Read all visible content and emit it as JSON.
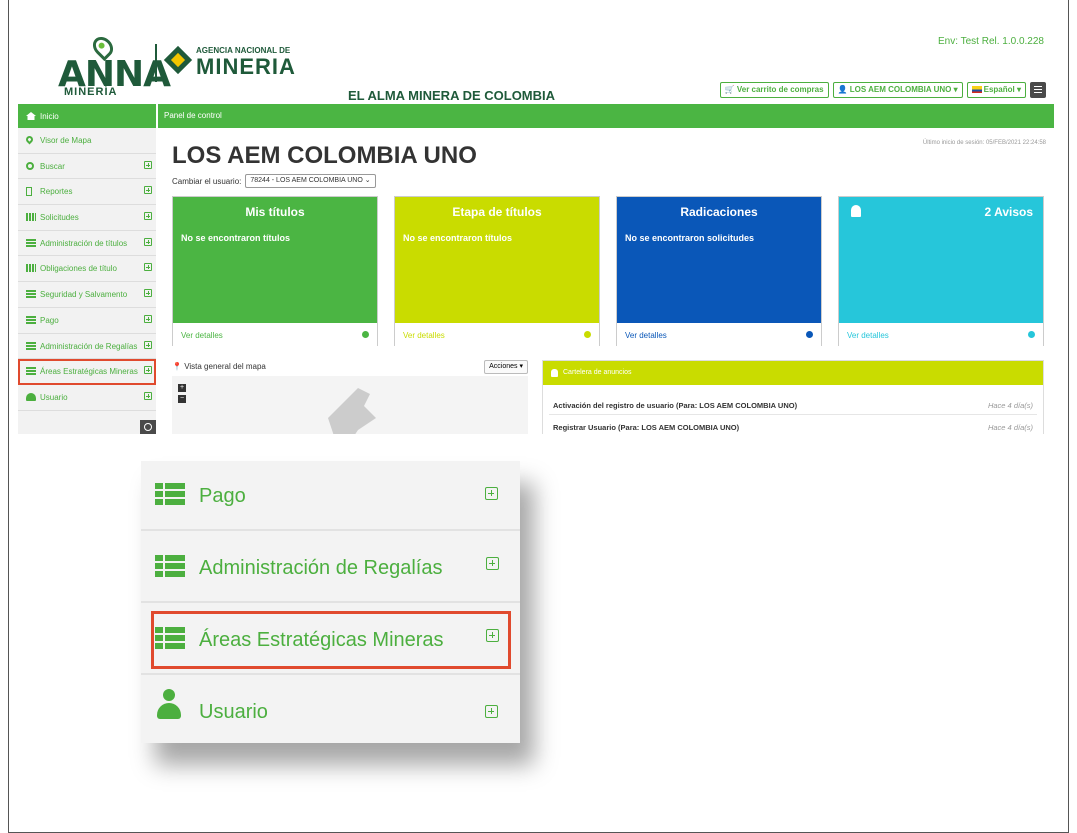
{
  "header": {
    "logo_text": "ANNA",
    "logo_sub": "MINERÍA",
    "agency_small": "AGENCIA NACIONAL DE",
    "agency_big": "MINERIA",
    "tagline": "EL ALMA MINERA DE COLOMBIA",
    "env": "Env: Test Rel. 1.0.0.228",
    "cart_button": "Ver carrito de compras",
    "user_button": "LOS AEM COLOMBIA UNO",
    "language_button": "Español"
  },
  "breadcrumb": "Panel de control",
  "sidebar": {
    "items": [
      {
        "label": "Inicio"
      },
      {
        "label": "Visor de Mapa"
      },
      {
        "label": "Buscar"
      },
      {
        "label": "Reportes"
      },
      {
        "label": "Solicitudes"
      },
      {
        "label": "Administración de títulos"
      },
      {
        "label": "Obligaciones de título"
      },
      {
        "label": "Seguridad y Salvamento"
      },
      {
        "label": "Pago"
      },
      {
        "label": "Administración de Regalías"
      },
      {
        "label": "Áreas Estratégicas Mineras"
      },
      {
        "label": "Usuario"
      }
    ]
  },
  "main": {
    "title": "LOS AEM COLOMBIA UNO",
    "last_login": "Último inicio de sesión: 05/FEB/2021 22:24:58",
    "change_user_label": "Cambiar el usuario:",
    "change_user_value": "78244 - LOS AEM COLOMBIA UNO",
    "cards": [
      {
        "title": "Mis títulos",
        "message": "No se encontraron títulos",
        "link": "Ver detalles",
        "color": "#4bb543"
      },
      {
        "title": "Etapa de títulos",
        "message": "No se encontraron títulos",
        "link": "Ver detalles",
        "color": "#c9dc00"
      },
      {
        "title": "Radicaciones",
        "message": "No se encontraron solicitudes",
        "link": "Ver detalles",
        "color": "#0a57b8"
      },
      {
        "title": "2 Avisos",
        "message": "",
        "link": "Ver detalles",
        "color": "#26c6da"
      }
    ],
    "map_label": "Vista general del mapa",
    "actions_button": "Acciones",
    "cartelera_title": "Cartelera de anuncios",
    "notices": [
      {
        "text": "Activación del registro de usuario (Para: LOS AEM COLOMBIA UNO)",
        "date": "Hace 4 día(s)"
      },
      {
        "text": "Registrar Usuario (Para: LOS AEM COLOMBIA UNO)",
        "date": "Hace 4 día(s)"
      }
    ]
  },
  "zoom_detail": {
    "items": [
      {
        "label": "Pago"
      },
      {
        "label": "Administración de Regalías"
      },
      {
        "label": "Áreas Estratégicas Mineras"
      },
      {
        "label": "Usuario"
      }
    ]
  },
  "colors": {
    "accent_green": "#4bb543",
    "highlight_red": "#e04a2e"
  }
}
